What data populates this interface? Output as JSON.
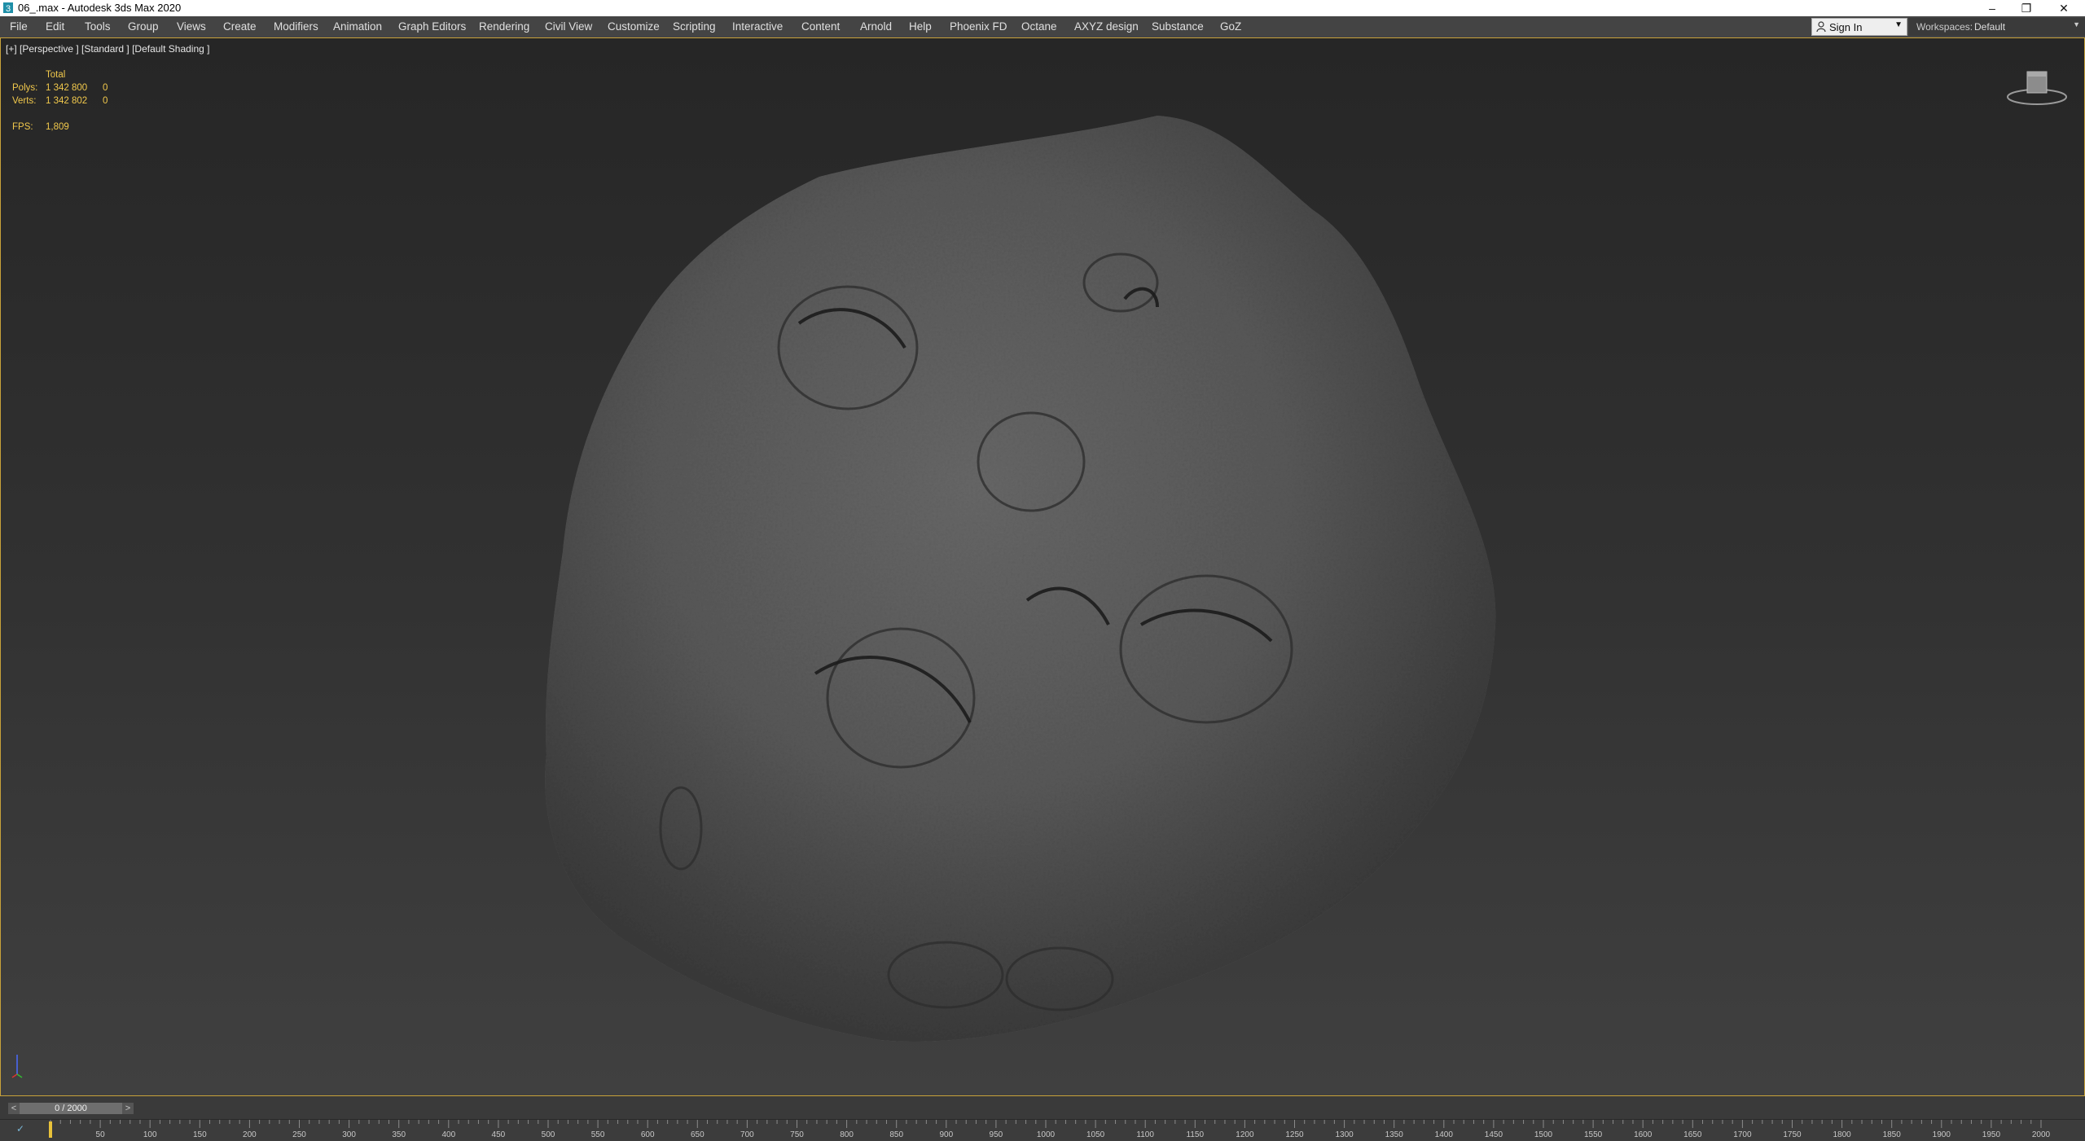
{
  "window": {
    "title": "06_.max - Autodesk 3ds Max 2020",
    "controls": [
      "–",
      "❐",
      "✕"
    ]
  },
  "menu": [
    {
      "label": "File"
    },
    {
      "label": "Edit"
    },
    {
      "label": "Tools"
    },
    {
      "label": "Group"
    },
    {
      "label": "Views"
    },
    {
      "label": "Create"
    },
    {
      "label": "Modifiers"
    },
    {
      "label": "Animation"
    },
    {
      "label": "Graph Editors"
    },
    {
      "label": "Rendering"
    },
    {
      "label": "Civil View"
    },
    {
      "label": "Customize"
    },
    {
      "label": "Scripting"
    },
    {
      "label": "Interactive"
    },
    {
      "label": "Content"
    },
    {
      "label": "Arnold"
    },
    {
      "label": "Help"
    },
    {
      "label": "Phoenix FD"
    },
    {
      "label": "Octane"
    },
    {
      "label": "AXYZ design"
    },
    {
      "label": "Substance"
    },
    {
      "label": "GoZ"
    }
  ],
  "signin": {
    "label": "Sign In"
  },
  "workspaces": {
    "label": "Workspaces:",
    "value": "Default"
  },
  "viewport": {
    "label": "[+] [Perspective ] [Standard ] [Default Shading ]",
    "stats": {
      "header": "Total",
      "polys_label": "Polys:",
      "polys_total": "1 342 800",
      "polys_sel": "0",
      "verts_label": "Verts:",
      "verts_total": "1 342 802",
      "verts_sel": "0",
      "fps_label": "FPS:",
      "fps_value": "1,809"
    }
  },
  "timeslider": {
    "value": "0 / 2000",
    "prev": "<",
    "next": ">"
  },
  "trackbar": {
    "ticks": [
      "50",
      "100",
      "150",
      "200",
      "250",
      "300",
      "350",
      "400",
      "450",
      "500",
      "550",
      "600",
      "650",
      "700",
      "750",
      "800",
      "850",
      "900",
      "950",
      "1000",
      "1050",
      "1100",
      "1150",
      "1200",
      "1250",
      "1300",
      "1350",
      "1400",
      "1450",
      "1500",
      "1550",
      "1600",
      "1650",
      "1700",
      "1750",
      "1800",
      "1850",
      "1900",
      "1950",
      "2000"
    ]
  },
  "colors": {
    "stats": "#f2c94c",
    "active_border": "#c8a23a"
  }
}
